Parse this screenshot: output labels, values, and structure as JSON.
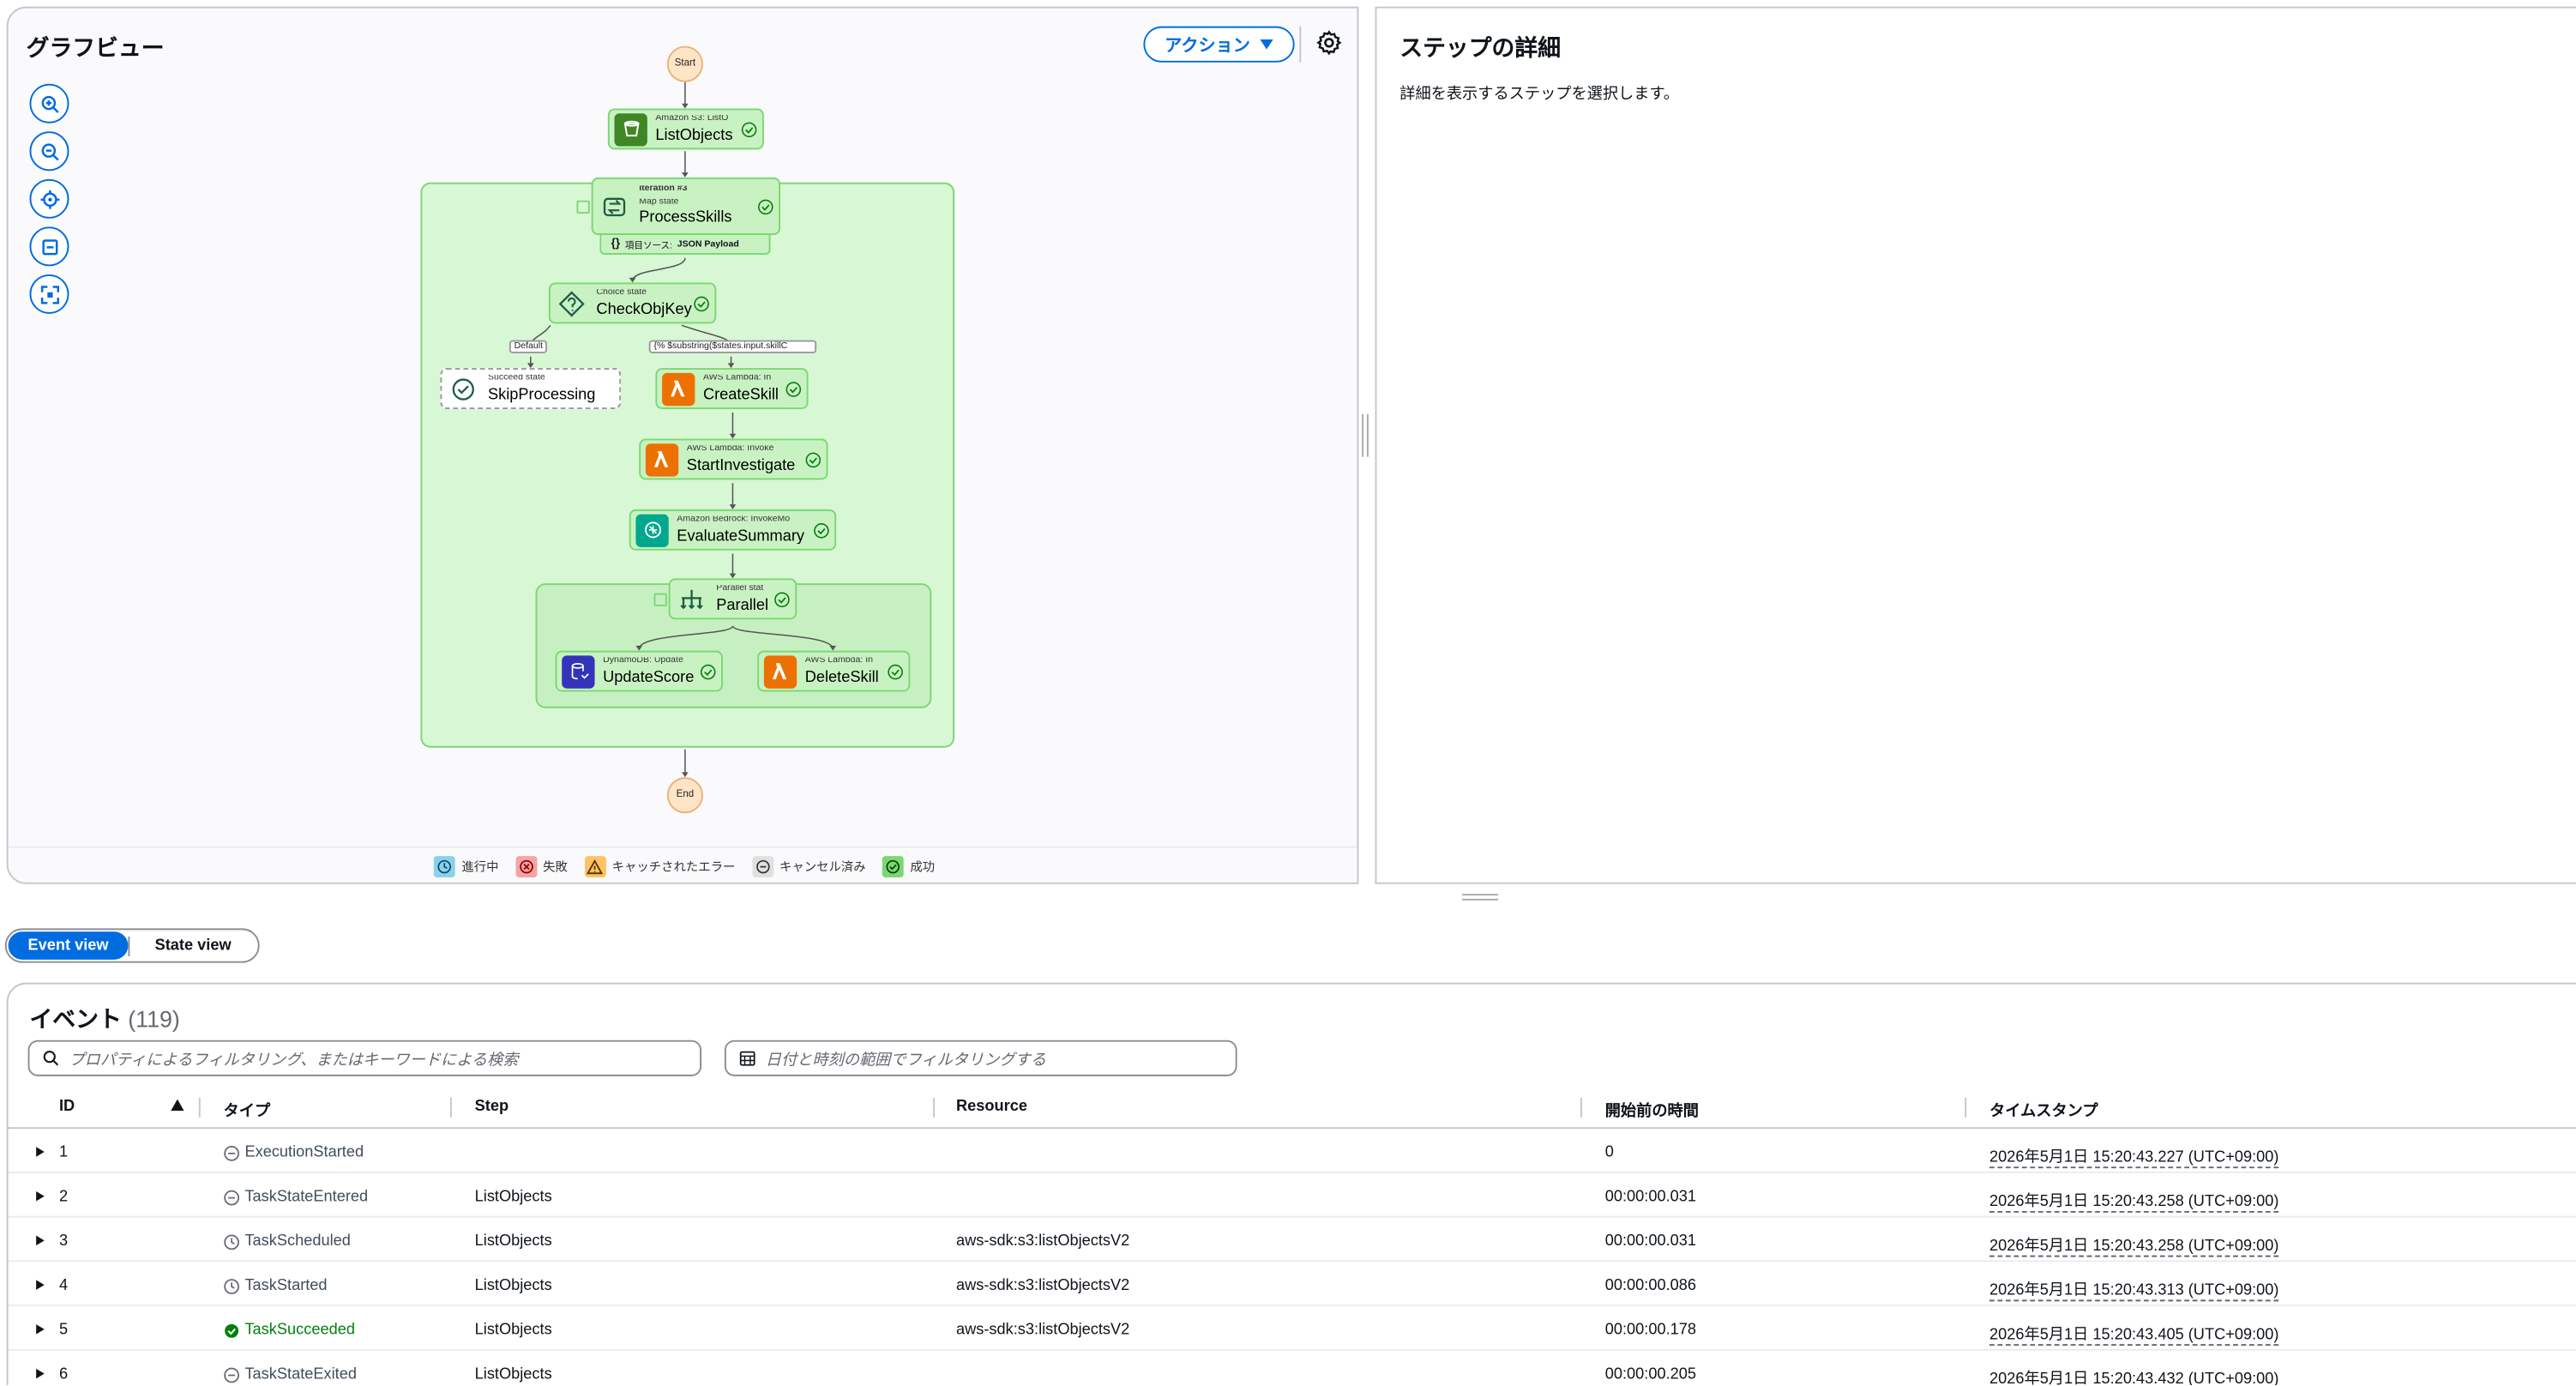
{
  "graph": {
    "title": "グラフビュー",
    "action_label": "アクション",
    "nodes": {
      "start": "Start",
      "end": "End",
      "listobjects": {
        "type": "Amazon S3: ListO",
        "name": "ListObjects"
      },
      "processskills": {
        "iteration": "Iteration #3",
        "type": "Map state",
        "name": "ProcessSkills",
        "source_label": "項目ソース:",
        "source_value": "JSON Payload"
      },
      "checkobjkey": {
        "type": "Choice state",
        "name": "CheckObjKey"
      },
      "skipprocessing": {
        "type": "Succeed state",
        "name": "SkipProcessing"
      },
      "createskill": {
        "type": "AWS Lambda: In",
        "name": "CreateSkill"
      },
      "startinvestigate": {
        "type": "AWS Lambda: Invoke",
        "name": "StartInvestigate"
      },
      "evaluatesummary": {
        "type": "Amazon Bedrock: InvokeMo",
        "name": "EvaluateSummary"
      },
      "parallel": {
        "type": "Parallel stat",
        "name": "Parallel"
      },
      "updatescore": {
        "type": "DynamoDB: Update",
        "name": "UpdateScore"
      },
      "deleteskill": {
        "type": "AWS Lambda: In",
        "name": "DeleteSkill"
      }
    },
    "edge_labels": {
      "default": "Default",
      "condition": "{% $substring($states.input.skillC"
    },
    "legend": [
      {
        "label": "進行中",
        "color": "#8ad1ea"
      },
      {
        "label": "失敗",
        "color": "#f5a3a3"
      },
      {
        "label": "キャッチされたエラー",
        "color": "#ffc266"
      },
      {
        "label": "キャンセル済み",
        "color": "#e0e0e0"
      },
      {
        "label": "成功",
        "color": "#7ad872"
      }
    ]
  },
  "details": {
    "title": "ステップの詳細",
    "hint": "詳細を表示するステップを選択します。"
  },
  "views": {
    "event": "Event view",
    "state": "State view"
  },
  "events": {
    "title": "イベント",
    "count": "(119)",
    "search_placeholder": "プロパティによるフィルタリング、またはキーワードによる検索",
    "date_placeholder": "日付と時刻の範囲でフィルタリングする",
    "columns": {
      "id": "ID",
      "type": "タイプ",
      "step": "Step",
      "resource": "Resource",
      "elapsed": "開始前の時間",
      "timestamp": "タイムスタンプ"
    },
    "rows": [
      {
        "id": "1",
        "type": "ExecutionStarted",
        "step": "",
        "resource": "",
        "elapsed": "0",
        "timestamp": "2026年5月1日 15:20:43.227 (UTC+09:00)"
      },
      {
        "id": "2",
        "type": "TaskStateEntered",
        "step": "ListObjects",
        "resource": "",
        "elapsed": "00:00:00.031",
        "timestamp": "2026年5月1日 15:20:43.258 (UTC+09:00)"
      },
      {
        "id": "3",
        "type": "TaskScheduled",
        "step": "ListObjects",
        "resource": "aws-sdk:s3:listObjectsV2",
        "elapsed": "00:00:00.031",
        "timestamp": "2026年5月1日 15:20:43.258 (UTC+09:00)"
      },
      {
        "id": "4",
        "type": "TaskStarted",
        "step": "ListObjects",
        "resource": "aws-sdk:s3:listObjectsV2",
        "elapsed": "00:00:00.086",
        "timestamp": "2026年5月1日 15:20:43.313 (UTC+09:00)"
      },
      {
        "id": "5",
        "type": "TaskSucceeded",
        "step": "ListObjects",
        "resource": "aws-sdk:s3:listObjectsV2",
        "elapsed": "00:00:00.178",
        "timestamp": "2026年5月1日 15:20:43.405 (UTC+09:00)"
      },
      {
        "id": "6",
        "type": "TaskStateExited",
        "step": "ListObjects",
        "resource": "",
        "elapsed": "00:00:00.205",
        "timestamp": "2026年5月1日 15:20:43.432 (UTC+09:00)"
      }
    ]
  },
  "colors": {
    "accent": "#006ce0",
    "success": "#037f0c",
    "s3": "#3f8624",
    "lambda": "#ed7100",
    "bedrock": "#01a88d",
    "dynamodb": "#3334b9"
  }
}
